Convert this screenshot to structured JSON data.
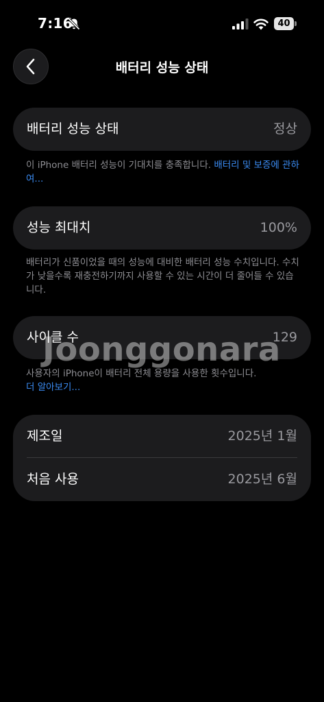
{
  "status_bar": {
    "time": "7:16",
    "battery_level": "40"
  },
  "nav": {
    "title": "배터리 성능 상태"
  },
  "health": {
    "label": "배터리 성능 상태",
    "value": "정상",
    "footnote_text": "이 iPhone 배터리 성능이 기대치를 충족합니다. ",
    "footnote_link": "배터리 및 보증에 관하여..."
  },
  "max_capacity": {
    "label": "성능 최대치",
    "value": "100%",
    "footnote": "배터리가 신품이었을 때의 성능에 대비한 배터리 성능 수치입니다. 수치가 낮을수록 재충전하기까지 사용할 수 있는 시간이 더 줄어들 수 있습니다."
  },
  "cycle_count": {
    "label": "사이클 수",
    "value": "129",
    "footnote_text": "사용자의 iPhone이 배터리 전체 용량을 사용한 횟수입니다.",
    "footnote_link": "더 알아보기..."
  },
  "dates": {
    "manufacture_label": "제조일",
    "manufacture_value": "2025년 1월",
    "first_use_label": "처음 사용",
    "first_use_value": "2025년 6월"
  },
  "watermark": "Joonggonara",
  "colors": {
    "background": "#000000",
    "card": "#1c1c1e",
    "secondary_text": "#8e8e93",
    "link": "#3b8df5"
  }
}
